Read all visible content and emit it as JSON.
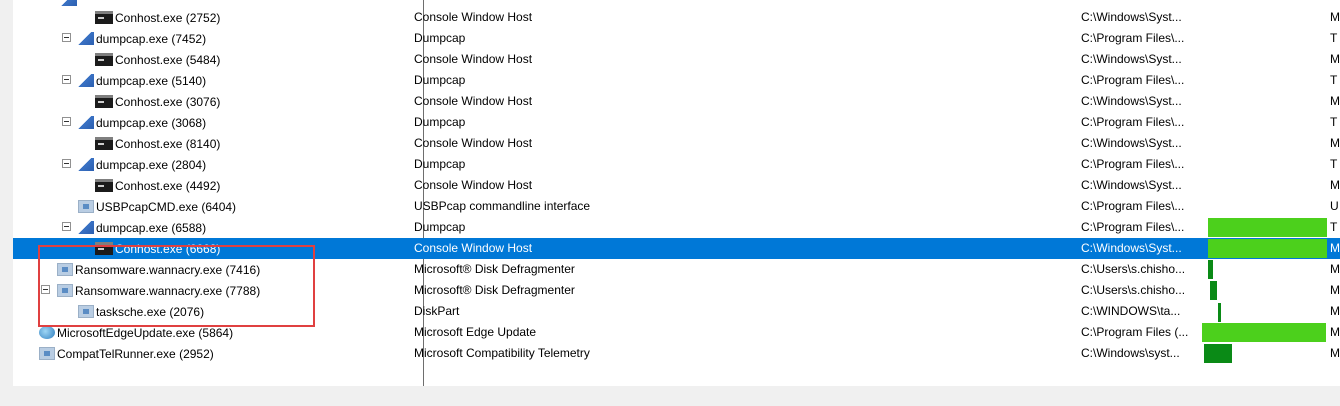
{
  "colors": {
    "selection": "#0078d7",
    "bar_bright": "#4cd01c",
    "bar_dark": "#0a8a16",
    "highlight_border": "#e04040"
  },
  "rows": [
    {
      "process": "Conhost.exe (2752)",
      "icon": "console-icon",
      "description": "Console Window Host",
      "path": "C:\\Windows\\Syst...",
      "company": "M"
    },
    {
      "process": "dumpcap.exe (7452)",
      "icon": "wireshark-fin-icon",
      "description": "Dumpcap",
      "path": "C:\\Program Files\\...",
      "company": "T"
    },
    {
      "process": "Conhost.exe (5484)",
      "icon": "console-icon",
      "description": "Console Window Host",
      "path": "C:\\Windows\\Syst...",
      "company": "M"
    },
    {
      "process": "dumpcap.exe (5140)",
      "icon": "wireshark-fin-icon",
      "description": "Dumpcap",
      "path": "C:\\Program Files\\...",
      "company": "T"
    },
    {
      "process": "Conhost.exe (3076)",
      "icon": "console-icon",
      "description": "Console Window Host",
      "path": "C:\\Windows\\Syst...",
      "company": "M"
    },
    {
      "process": "dumpcap.exe (3068)",
      "icon": "wireshark-fin-icon",
      "description": "Dumpcap",
      "path": "C:\\Program Files\\...",
      "company": "T"
    },
    {
      "process": "Conhost.exe (8140)",
      "icon": "console-icon",
      "description": "Console Window Host",
      "path": "C:\\Windows\\Syst...",
      "company": "M"
    },
    {
      "process": "dumpcap.exe (2804)",
      "icon": "wireshark-fin-icon",
      "description": "Dumpcap",
      "path": "C:\\Program Files\\...",
      "company": "T"
    },
    {
      "process": "Conhost.exe (4492)",
      "icon": "console-icon",
      "description": "Console Window Host",
      "path": "C:\\Windows\\Syst...",
      "company": "M"
    },
    {
      "process": "USBPcapCMD.exe (6404)",
      "icon": "generic-app-icon",
      "description": "USBPcap commandline interface",
      "path": "C:\\Program Files\\...",
      "company": "U"
    },
    {
      "process": "dumpcap.exe (6588)",
      "icon": "wireshark-fin-icon",
      "description": "Dumpcap",
      "path": "C:\\Program Files\\...",
      "company": "T"
    },
    {
      "process": "Conhost.exe (6668)",
      "icon": "console-icon",
      "description": "Console Window Host",
      "path": "C:\\Windows\\Syst...",
      "company": "M"
    },
    {
      "process": "Ransomware.wannacry.exe (7416)",
      "icon": "generic-app-icon",
      "description": "Microsoft® Disk Defragmenter",
      "path": "C:\\Users\\s.chisho...",
      "company": "M"
    },
    {
      "process": "Ransomware.wannacry.exe (7788)",
      "icon": "generic-app-icon",
      "description": "Microsoft® Disk Defragmenter",
      "path": "C:\\Users\\s.chisho...",
      "company": "M"
    },
    {
      "process": "tasksche.exe (2076)",
      "icon": "generic-app-icon",
      "description": "DiskPart",
      "path": "C:\\WINDOWS\\ta...",
      "company": "M"
    },
    {
      "process": "MicrosoftEdgeUpdate.exe (5864)",
      "icon": "edge-update-icon",
      "description": "Microsoft Edge Update",
      "path": "C:\\Program Files (...",
      "company": "M"
    },
    {
      "process": "CompatTelRunner.exe (2952)",
      "icon": "generic-app-icon",
      "description": "Microsoft Compatibility Telemetry",
      "path": "C:\\Windows\\syst...",
      "company": "M"
    }
  ]
}
